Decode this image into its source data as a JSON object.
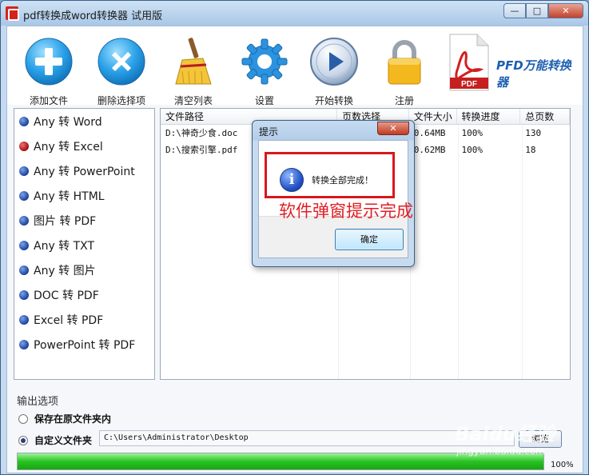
{
  "window": {
    "title": "pdf转换成word转换器 试用版",
    "min_label": "—",
    "max_label": "□",
    "close_label": "✕"
  },
  "toolbar": {
    "items": [
      {
        "label": "添加文件",
        "icon": "add-icon"
      },
      {
        "label": "删除选择项",
        "icon": "delete-icon"
      },
      {
        "label": "清空列表",
        "icon": "broom-icon"
      },
      {
        "label": "设置",
        "icon": "gear-icon"
      },
      {
        "label": "开始转换",
        "icon": "play-icon"
      },
      {
        "label": "注册",
        "icon": "lock-icon"
      }
    ],
    "brand": "PFD万能转换器",
    "brand_logo_text": "PDF"
  },
  "left_menu": {
    "items": [
      {
        "label": "Any 转 Word",
        "active": false
      },
      {
        "label": "Any 转 Excel",
        "active": true
      },
      {
        "label": "Any 转 PowerPoint",
        "active": false
      },
      {
        "label": "Any 转 HTML",
        "active": false
      },
      {
        "label": "图片 转 PDF",
        "active": false
      },
      {
        "label": "Any 转 TXT",
        "active": false
      },
      {
        "label": "Any 转 图片",
        "active": false
      },
      {
        "label": "DOC 转 PDF",
        "active": false
      },
      {
        "label": "Excel 转 PDF",
        "active": false
      },
      {
        "label": "PowerPoint 转 PDF",
        "active": false
      }
    ]
  },
  "file_table": {
    "columns": [
      "文件路径",
      "页数选择",
      "文件大小",
      "转换进度",
      "总页数"
    ],
    "rows": [
      {
        "path": "D:\\神奇少食.doc",
        "pages": "",
        "size": "0.64MB",
        "progress": "100%",
        "total": "130"
      },
      {
        "path": "D:\\搜索引擎.pdf",
        "pages": "",
        "size": "0.62MB",
        "progress": "100%",
        "total": "18"
      }
    ]
  },
  "output": {
    "section_label": "输出选项",
    "option_original": "保存在原文件夹内",
    "option_custom": "自定义文件夹",
    "selected": "custom",
    "path": "C:\\Users\\Administrator\\Desktop",
    "browse_label": "浏览"
  },
  "progress": {
    "value": 1.0,
    "label": "100%"
  },
  "dialog": {
    "title": "提示",
    "close_label": "✕",
    "message": "转换全部完成！",
    "ok_label": "确定",
    "icon": "info-icon",
    "icon_glyph": "i"
  },
  "annotation": {
    "text": "软件弹窗提示完成",
    "color": "#e01f24"
  },
  "watermark": {
    "text": "Baidu经验",
    "sub": "jingyan.baidu.com"
  },
  "colors": {
    "accent": "#1e5fb0",
    "progress": "#27c421",
    "highlight": "#d8171d"
  }
}
